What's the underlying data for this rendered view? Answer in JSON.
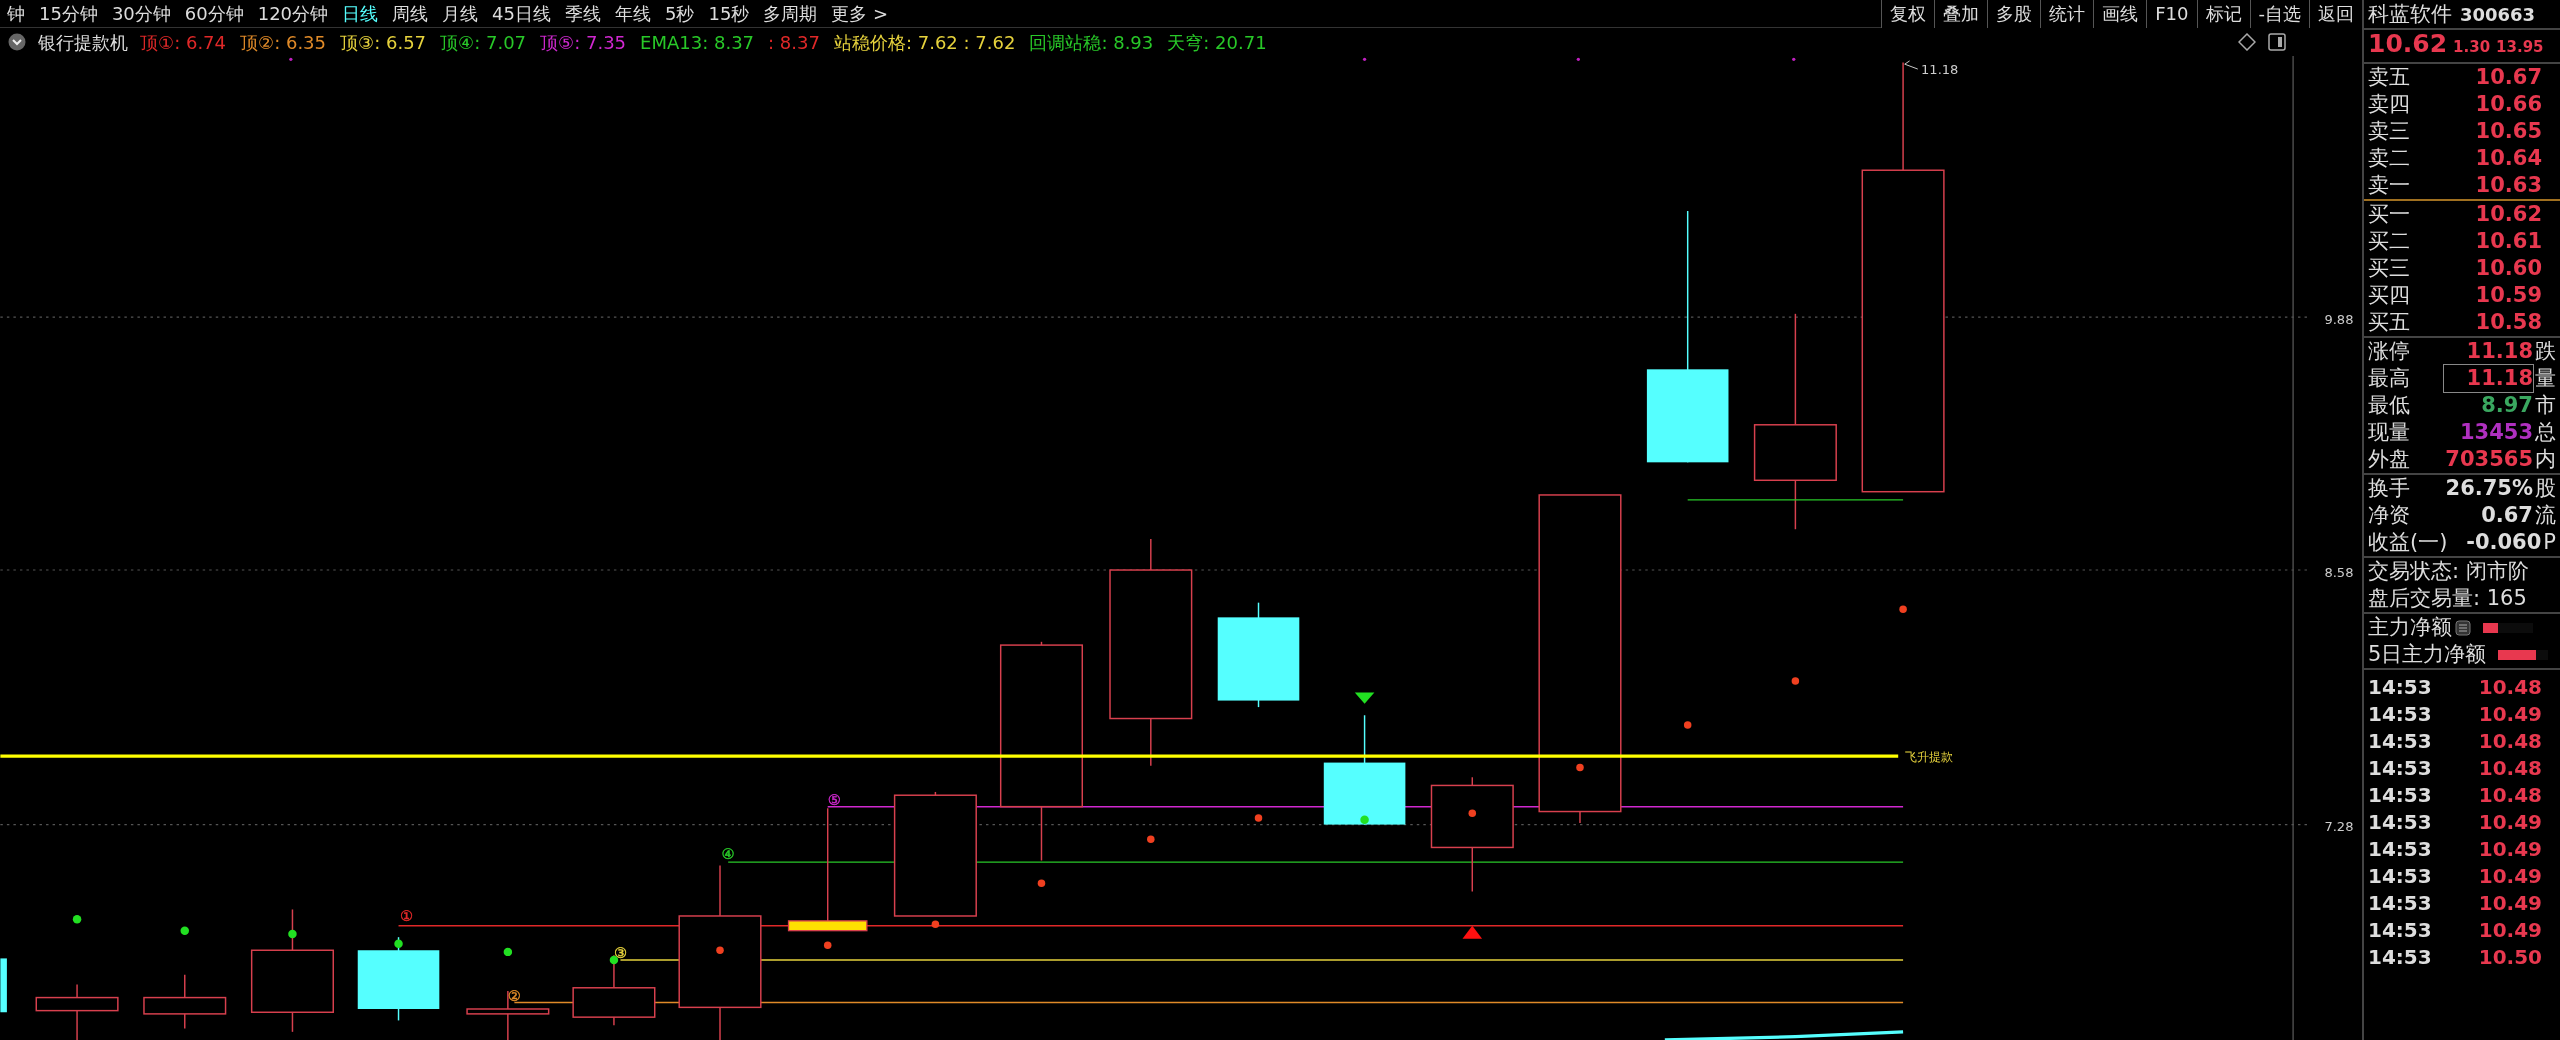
{
  "period_tabs": [
    {
      "label": "钟",
      "selected": false
    },
    {
      "label": "15分钟",
      "selected": false
    },
    {
      "label": "30分钟",
      "selected": false
    },
    {
      "label": "60分钟",
      "selected": false
    },
    {
      "label": "120分钟",
      "selected": false
    },
    {
      "label": "日线",
      "selected": true
    },
    {
      "label": "周线",
      "selected": false
    },
    {
      "label": "月线",
      "selected": false
    },
    {
      "label": "45日线",
      "selected": false
    },
    {
      "label": "季线",
      "selected": false
    },
    {
      "label": "年线",
      "selected": false
    },
    {
      "label": "5秒",
      "selected": false
    },
    {
      "label": "15秒",
      "selected": false
    },
    {
      "label": "多周期",
      "selected": false
    },
    {
      "label": "更多 >",
      "selected": false
    }
  ],
  "toolbar_buttons": [
    "复权",
    "叠加",
    "多股",
    "统计",
    "画线",
    "F10",
    "标记",
    "-自选",
    "返回"
  ],
  "indicator": {
    "name": "银行提款机",
    "legend": [
      {
        "text": "顶①: 6.74",
        "color": "#e02828"
      },
      {
        "text": "顶②: 6.35",
        "color": "#e08a28"
      },
      {
        "text": "顶③: 6.57",
        "color": "#e6d23c"
      },
      {
        "text": "顶④: 7.07",
        "color": "#28c828"
      },
      {
        "text": "顶⑤: 7.35",
        "color": "#d028d0"
      },
      {
        "text": "EMA13: 8.37",
        "color": "#28c828"
      },
      {
        "text": ": 8.37",
        "color": "#e02828"
      },
      {
        "text": "站稳价格: 7.62 : 7.62",
        "color": "#e6d23c"
      },
      {
        "text": "回调站稳: 8.93",
        "color": "#28c828"
      },
      {
        "text": "天穹: 20.71",
        "color": "#28c828"
      }
    ]
  },
  "chart": {
    "y_axis_labels": [
      "9.88",
      "8.58",
      "7.28"
    ],
    "high_label": "11.18",
    "signal_line_label": "飞升提款",
    "markers": [
      {
        "text": "①",
        "color": "#e02828"
      },
      {
        "text": "②",
        "color": "#e08a28"
      },
      {
        "text": "③",
        "color": "#e6d23c"
      },
      {
        "text": "④",
        "color": "#28c828"
      },
      {
        "text": "⑤",
        "color": "#d028d0"
      }
    ]
  },
  "quote": {
    "name": "科蓝软件",
    "code": "300663",
    "price": "10.62",
    "change": "1.30",
    "change_pct": "13.95"
  },
  "sell_orders": [
    {
      "label": "卖五",
      "price": "10.67"
    },
    {
      "label": "卖四",
      "price": "10.66"
    },
    {
      "label": "卖三",
      "price": "10.65"
    },
    {
      "label": "卖二",
      "price": "10.64"
    },
    {
      "label": "卖一",
      "price": "10.63"
    }
  ],
  "buy_orders": [
    {
      "label": "买一",
      "price": "10.62"
    },
    {
      "label": "买二",
      "price": "10.61"
    },
    {
      "label": "买三",
      "price": "10.60"
    },
    {
      "label": "买四",
      "price": "10.59"
    },
    {
      "label": "买五",
      "price": "10.58"
    }
  ],
  "stats": [
    {
      "label": "涨停",
      "value": "11.18",
      "color": "#e8384f",
      "highlighted": false,
      "column_3": "跌"
    },
    {
      "label": "最高",
      "value": "11.18",
      "color": "#e8384f",
      "highlighted": true,
      "column_3": "量"
    },
    {
      "label": "最低",
      "value": "8.97",
      "color": "#3aa860",
      "highlighted": false,
      "column_3": "市"
    },
    {
      "label": "现量",
      "value": "13453",
      "color": "#b030c0",
      "highlighted": false,
      "column_3": "总"
    },
    {
      "label": "外盘",
      "value": "703565",
      "color": "#e8384f",
      "highlighted": false,
      "column_3": "内"
    }
  ],
  "fundamentals": [
    {
      "label": "换手",
      "value": "26.75%",
      "column_3": "股"
    },
    {
      "label": "净资",
      "value": "0.67",
      "column_3": "流"
    },
    {
      "label": "收益(一)",
      "value": "-0.060",
      "column_3": "P"
    }
  ],
  "trade_status": [
    "交易状态: 闭市阶",
    "盘后交易量: 165"
  ],
  "fund_flow": [
    {
      "label": "主力净额",
      "level": 0.3
    },
    {
      "label": "5日主力净额",
      "level": 0.75
    }
  ],
  "ticks": [
    {
      "time": "14:53",
      "price": "10.48"
    },
    {
      "time": "14:53",
      "price": "10.49"
    },
    {
      "time": "14:53",
      "price": "10.48"
    },
    {
      "time": "14:53",
      "price": "10.48"
    },
    {
      "time": "14:53",
      "price": "10.48"
    },
    {
      "time": "14:53",
      "price": "10.49"
    },
    {
      "time": "14:53",
      "price": "10.49"
    },
    {
      "time": "14:53",
      "price": "10.49"
    },
    {
      "time": "14:53",
      "price": "10.49"
    },
    {
      "time": "14:53",
      "price": "10.49"
    },
    {
      "time": "14:53",
      "price": "10.50"
    }
  ]
}
